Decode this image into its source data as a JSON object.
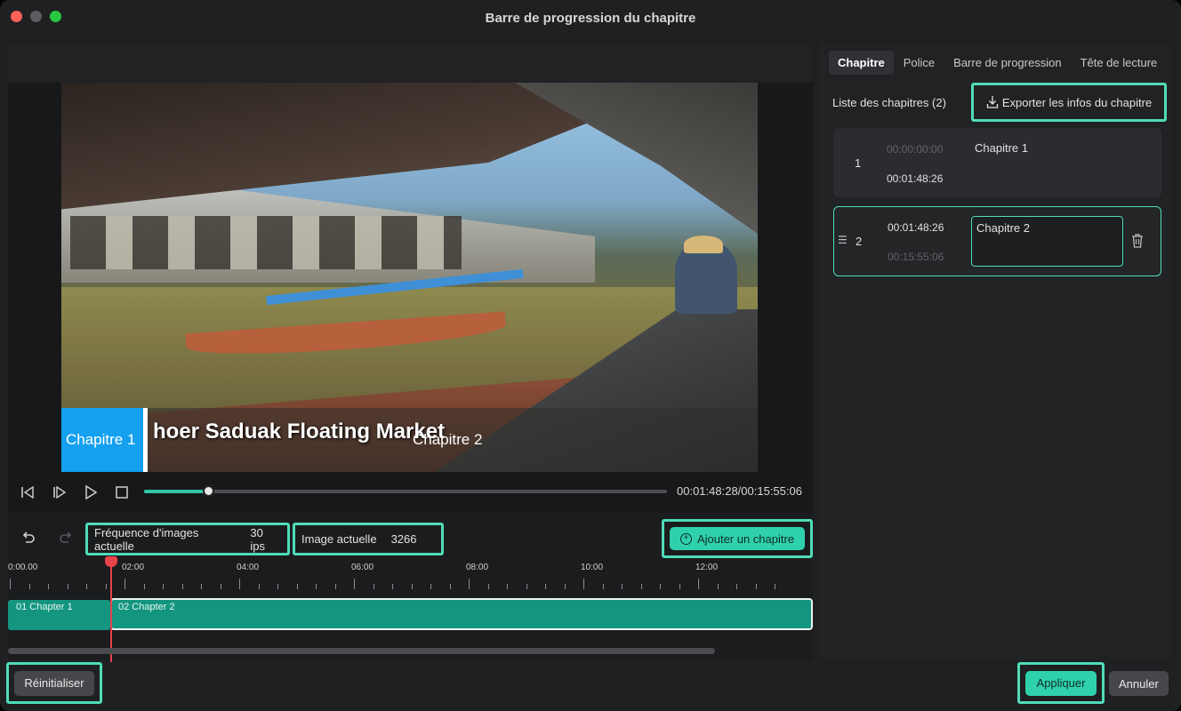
{
  "window": {
    "title": "Barre de progression du chapitre"
  },
  "video": {
    "caption_chapter1": "Chapitre 1",
    "caption_title": "hoer Saduak Floating Market",
    "caption_chapter2": "Chapitre 2"
  },
  "player": {
    "timecode": "00:01:48:28/00:15:55:06",
    "progress": 0.123
  },
  "timeline_toolbar": {
    "frame_rate_label": "Fréquence d'images actuelle",
    "frame_rate_value": "30 ips",
    "current_frame_label": "Image actuelle",
    "current_frame_value": "3266",
    "add_chapter_label": "Ajouter un chapitre"
  },
  "ruler": {
    "labels": [
      "0:00.00",
      "02:00",
      "04:00",
      "06:00",
      "08:00",
      "10:00",
      "12:00"
    ]
  },
  "timeline_clips": [
    {
      "label": "01 Chapter 1"
    },
    {
      "label": "02 Chapter 2"
    }
  ],
  "right_panel": {
    "tabs": [
      "Chapitre",
      "Police",
      "Barre de progression",
      "Tête de lecture"
    ],
    "active_tab": "Chapitre",
    "list_header": "Liste des chapitres (2)",
    "export_label": "Exporter les infos du chapitre",
    "chapters": [
      {
        "index": "1",
        "start": "00:00:00:00",
        "end": "00:01:48:26",
        "name": "Chapitre 1"
      },
      {
        "index": "2",
        "start": "00:01:48:26",
        "end": "00:15:55:06",
        "name": "Chapitre 2"
      }
    ]
  },
  "footer": {
    "reset_label": "Réinitialiser",
    "apply_label": "Appliquer",
    "cancel_label": "Annuler"
  },
  "colors": {
    "accent": "#2fd1ad",
    "highlight": "#4fdcb8",
    "playhead": "#e8424b",
    "chapter1_caption": "#14a0ef"
  }
}
